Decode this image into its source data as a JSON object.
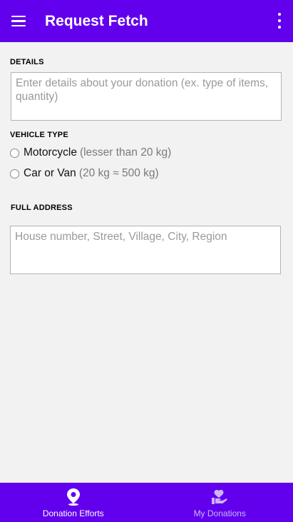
{
  "appbar": {
    "title": "Request Fetch",
    "menu_icon": "hamburger-menu-icon",
    "more_icon": "more-vertical-icon"
  },
  "details": {
    "label": "DETAILS",
    "placeholder": "Enter details about your donation (ex. type of items, quantity)"
  },
  "vehicle": {
    "label": "VEHICLE TYPE",
    "options": [
      {
        "name": "Motorcycle",
        "detail": "(lesser than 20 kg)",
        "selected": false
      },
      {
        "name": "Car or Van",
        "detail": "(20 kg ≈ 500 kg)",
        "selected": false
      }
    ]
  },
  "address": {
    "label": "FULL ADDRESS",
    "placeholder": "House number, Street, Village, City, Region"
  },
  "bottom_nav": {
    "items": [
      {
        "label": "Donation Efforts",
        "icon": "location-pin-icon",
        "active": true
      },
      {
        "label": "My Donations",
        "icon": "heart-hand-icon",
        "active": false
      }
    ]
  },
  "colors": {
    "primary": "#6200ee",
    "background": "#f2f2f2"
  }
}
